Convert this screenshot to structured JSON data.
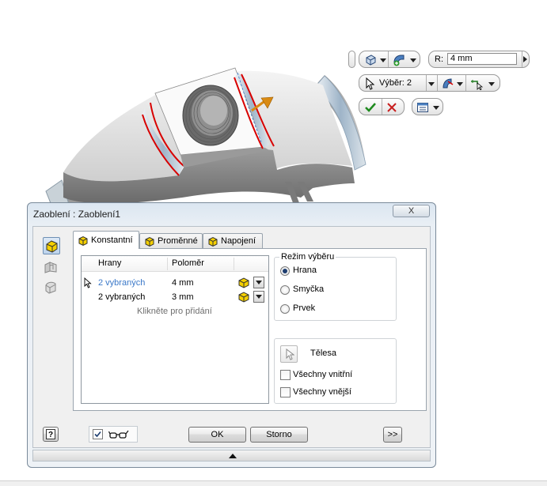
{
  "minitoolbar": {
    "radius_label": "R:",
    "radius_value": "4 mm",
    "selection_label": "Výběr: 2"
  },
  "dialog": {
    "title": "Zaoblení : Zaoblení1",
    "tabs": [
      {
        "label": "Konstantní"
      },
      {
        "label": "Proměnné"
      },
      {
        "label": "Napojení"
      }
    ],
    "table": {
      "headers": [
        "Hrany",
        "Poloměr"
      ],
      "rows": [
        {
          "edges": "2 vybraných",
          "radius": "4 mm"
        },
        {
          "edges": "2 vybraných",
          "radius": "3 mm"
        }
      ],
      "add_hint": "Klikněte pro přidání"
    },
    "selection_mode": {
      "legend": "Režim výběru",
      "options": [
        "Hrana",
        "Smyčka",
        "Prvek"
      ],
      "selected": "Hrana"
    },
    "bodies": {
      "label": "Tělesa",
      "all_inner": "Všechny vnitřní",
      "all_outer": "Všechny vnější"
    },
    "buttons": {
      "ok": "OK",
      "cancel": "Storno",
      "more": ">>",
      "close": "X"
    },
    "preview_checked": true
  },
  "colors": {
    "selected_edge": "#d80000",
    "link_blue": "#3a78c8",
    "arrow_orange": "#d98a12"
  }
}
